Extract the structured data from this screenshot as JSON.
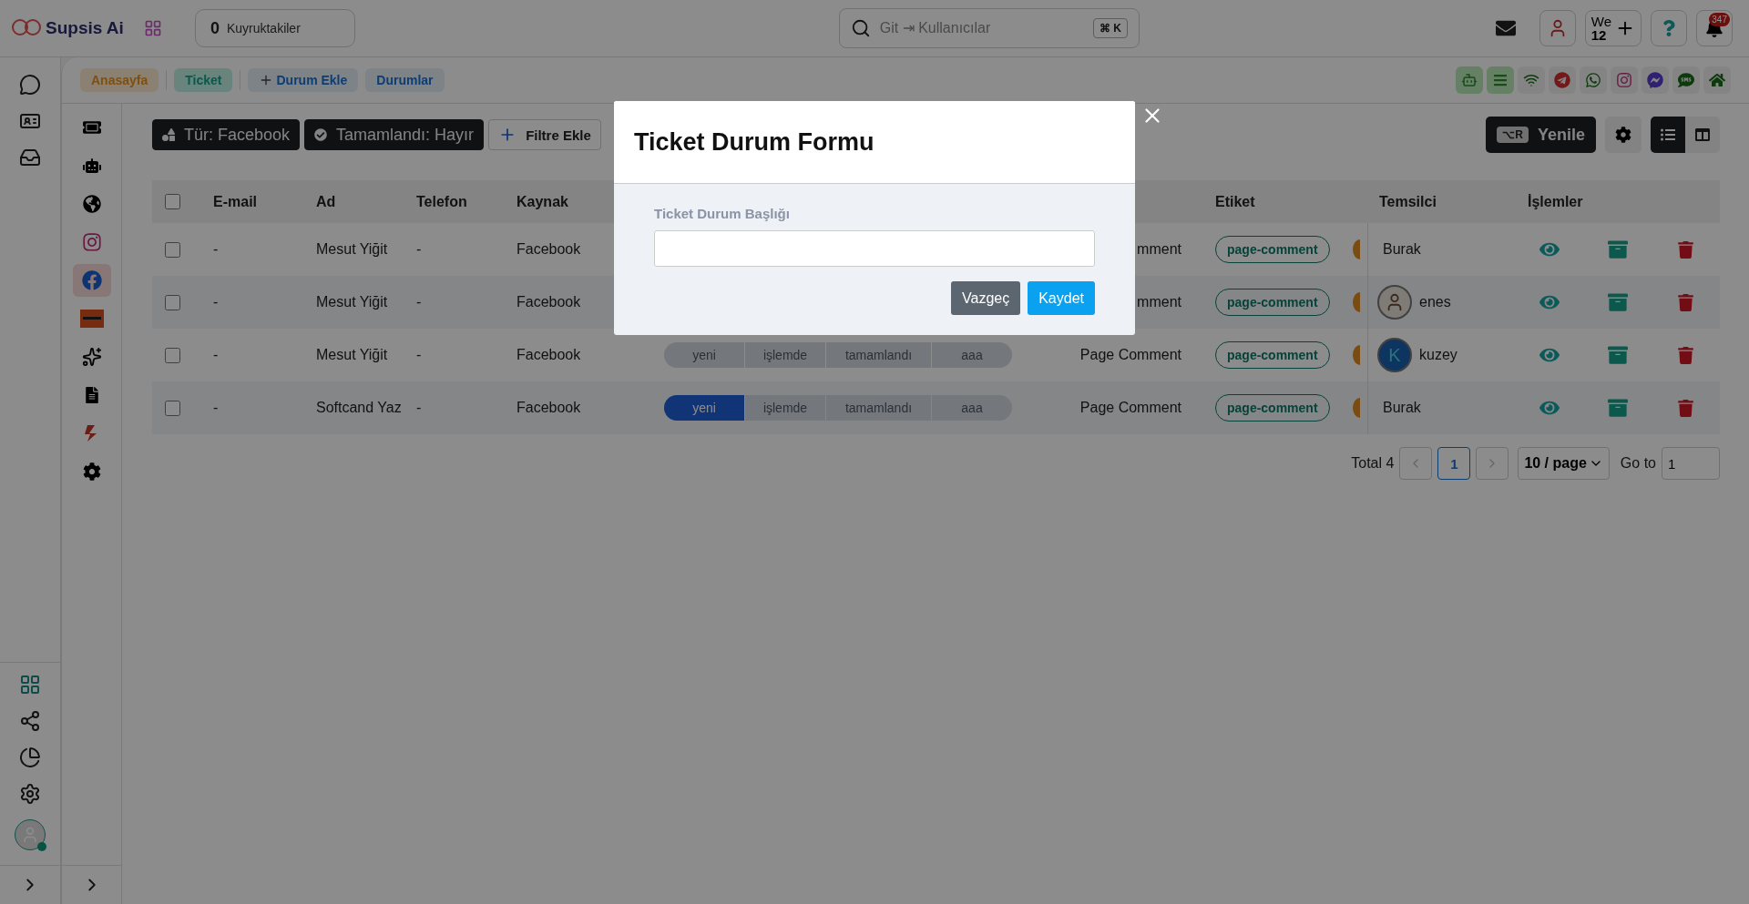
{
  "app": {
    "logo": "Supsis Ai"
  },
  "queue": {
    "count": "0",
    "label": "Kuyruktakiler"
  },
  "search": {
    "placeholder": "Git ⇥ Kullanıcılar",
    "shortcut": "⌘ K"
  },
  "header_actions": {
    "workspace_label": "We",
    "workspace_count": "12",
    "notifications": "347"
  },
  "breadcrumbs": [
    {
      "label": "Anasayfa",
      "kind": "home"
    },
    {
      "label": "Ticket",
      "kind": "current"
    },
    {
      "label": "Durum Ekle",
      "kind": "add"
    },
    {
      "label": "Durumlar",
      "kind": "link"
    }
  ],
  "channels": [
    {
      "selected": true
    },
    {
      "selected": true
    },
    {
      "selected": false
    },
    {
      "selected": false
    },
    {
      "selected": false
    },
    {
      "selected": false
    },
    {
      "selected": false
    },
    {
      "selected": false
    },
    {
      "selected": false
    }
  ],
  "sub_nav": [
    {
      "selected": false
    },
    {
      "selected": false
    },
    {
      "selected": false
    },
    {
      "selected": false
    },
    {
      "selected": true
    },
    {
      "selected": false
    },
    {
      "selected": false
    },
    {
      "selected": false
    },
    {
      "selected": false
    },
    {
      "selected": false
    }
  ],
  "filters": [
    {
      "label": "Tür: Facebook",
      "kind": "type"
    },
    {
      "label": "Tamamlandı: Hayır",
      "kind": "done"
    },
    {
      "label": "Filtre Ekle",
      "kind": "add"
    }
  ],
  "toolbar": {
    "refresh_shortcut": "⌥R",
    "refresh_label": "Yenile",
    "views": [
      {
        "selected": true
      },
      {
        "selected": false
      }
    ]
  },
  "table": {
    "all_checked": false,
    "columns": [
      "E-mail",
      "Ad",
      "Telefon",
      "Kaynak",
      "Etiket",
      "Temsilci",
      "İşlemler"
    ],
    "rows": [
      {
        "checked": false,
        "email": "-",
        "name": "Mesut Yiğit",
        "phone": "-",
        "source": "Facebook",
        "comment": "mment",
        "tag": "page-comment",
        "agent": {
          "name": "Burak",
          "kind": "none"
        }
      },
      {
        "checked": false,
        "email": "-",
        "name": "Mesut Yiğit",
        "phone": "-",
        "source": "Facebook",
        "comment": "mment",
        "tag": "page-comment",
        "agent": {
          "name": "enes",
          "kind": "photo"
        }
      },
      {
        "checked": false,
        "email": "-",
        "name": "Mesut Yiğit",
        "phone": "-",
        "source": "Facebook",
        "status": [
          {
            "label": "yeni",
            "selected": false
          },
          {
            "label": "işlemde",
            "selected": false
          },
          {
            "label": "tamamlandı",
            "selected": false
          },
          {
            "label": "aaa",
            "selected": false
          }
        ],
        "comment": "Page Comment",
        "tag": "page-comment",
        "agent": {
          "name": "kuzey",
          "kind": "letter",
          "letter": "K"
        }
      },
      {
        "checked": false,
        "email": "-",
        "name": "Softcand Yaz",
        "phone": "-",
        "source": "Facebook",
        "status": [
          {
            "label": "yeni",
            "selected": true
          },
          {
            "label": "işlemde",
            "selected": false
          },
          {
            "label": "tamamlandı",
            "selected": false
          },
          {
            "label": "aaa",
            "selected": false
          }
        ],
        "comment": "Page Comment",
        "tag": "page-comment",
        "agent": {
          "name": "Burak",
          "kind": "none"
        }
      }
    ]
  },
  "pagination": {
    "total": "Total 4",
    "pages": [
      {
        "label": "1",
        "selected": true
      }
    ],
    "page_size": "10 / page",
    "goto_label": "Go to",
    "goto_value": "1"
  },
  "modal": {
    "title": "Ticket Durum Formu",
    "field_label": "Ticket Durum Başlığı",
    "buttons": [
      {
        "label": "Vazgeç",
        "kind": "secondary"
      },
      {
        "label": "Kaydet",
        "kind": "primary"
      }
    ]
  }
}
